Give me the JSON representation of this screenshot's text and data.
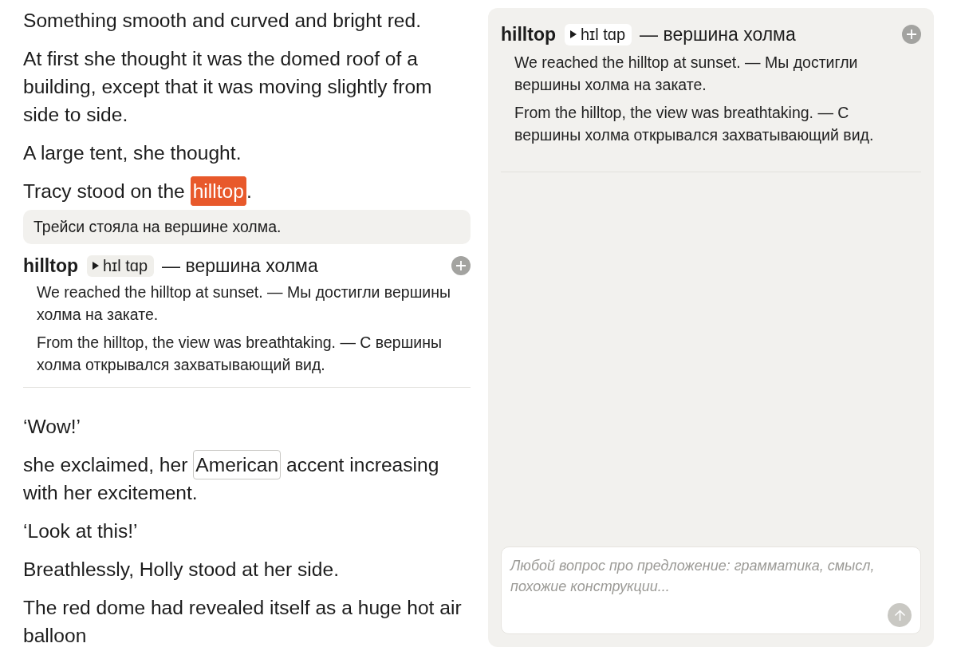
{
  "reader": {
    "blocks": [
      {
        "kind": "paragraph",
        "text": "Something smooth and curved and bright red."
      },
      {
        "kind": "paragraph",
        "text": "At first she thought it was the domed roof of a building, except that it was moving slightly from side to side."
      },
      {
        "kind": "paragraph",
        "text": "A large tent, she thought."
      },
      {
        "kind": "paragraph",
        "parts": [
          {
            "kind": "text",
            "text": "Tracy stood on the "
          },
          {
            "kind": "word",
            "text": "hilltop",
            "selected": true,
            "hovered": false
          },
          {
            "kind": "text",
            "text": "."
          }
        ]
      },
      {
        "kind": "translation",
        "text": "Трейси стояла на вершине холма."
      },
      {
        "kind": "entry",
        "word": "hilltop",
        "pronunciation": "hɪl tɑp",
        "translation": "— вершина холма",
        "examples": [
          "We reached the hilltop at sunset. — Мы достигли вершины холма на закате.",
          "From the hilltop, the view was breathtaking. — С вершины холма открывался захватывающий вид."
        ]
      },
      {
        "kind": "paragraph",
        "text": "‘Wow!’"
      },
      {
        "kind": "paragraph",
        "parts": [
          {
            "kind": "text",
            "text": "she exclaimed, her "
          },
          {
            "kind": "word",
            "text": "American",
            "selected": false,
            "hovered": true
          },
          {
            "kind": "text",
            "text": " accent increasing with her excitement."
          }
        ]
      },
      {
        "kind": "paragraph",
        "text": "‘Look at this!’"
      },
      {
        "kind": "paragraph",
        "text": "Breathlessly, Holly stood at her side."
      },
      {
        "kind": "paragraph",
        "text": "The red dome had revealed itself as a huge hot air balloon"
      }
    ]
  },
  "side_panel": {
    "entry": {
      "word": "hilltop",
      "pronunciation": "hɪl tɑp",
      "translation": "— вершина холма",
      "examples": [
        "We reached the hilltop at sunset. — Мы достигли вершины холма на закате.",
        "From the hilltop, the view was breathtaking. — С вершины холма открывался захватывающий вид."
      ]
    },
    "question_box": {
      "placeholder": "Любой вопрос про предложение: грамматика, смысл, похожие конструкции..."
    }
  }
}
